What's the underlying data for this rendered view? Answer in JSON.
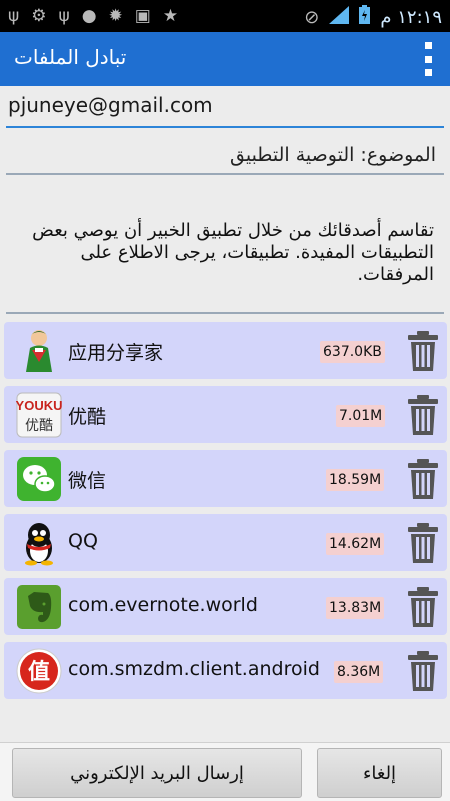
{
  "status_bar": {
    "time": "١٢:١٩ م",
    "icons": [
      "usb-icon",
      "android-debug-icon",
      "usb-icon",
      "android-face-icon",
      "settings-gear-icon",
      "image-icon",
      "star-icon"
    ],
    "right_icons": [
      "mute-icon",
      "signal-icon",
      "battery-charging-icon"
    ]
  },
  "app_bar": {
    "title": "تبادل الملفات",
    "menu_icon": "overflow-menu-icon"
  },
  "compose": {
    "to": "pjuneye@gmail.com",
    "subject": "الموضوع: التوصية التطبيق",
    "body": "تقاسم أصدقائك من خلال تطبيق الخبير أن يوصي بعض التطبيقات المفيدة. تطبيقات، يرجى الاطلاع على المرفقات."
  },
  "attachments": [
    {
      "name": "应用分享家",
      "size": "637.0KB",
      "icon": "share-expert-app-icon"
    },
    {
      "name": "优酷",
      "size": "7.01M",
      "icon": "youku-app-icon"
    },
    {
      "name": "微信",
      "size": "18.59M",
      "icon": "wechat-app-icon"
    },
    {
      "name": "QQ",
      "size": "14.62M",
      "icon": "qq-app-icon"
    },
    {
      "name": "com.evernote.world",
      "size": "13.83M",
      "icon": "evernote-app-icon"
    },
    {
      "name": "com.smzdm.client.android",
      "size": "8.36M",
      "icon": "smzdm-app-icon"
    }
  ],
  "buttons": {
    "send": "إرسال البريد الإلكتروني",
    "cancel": "إلغاء"
  },
  "icon_text": {
    "youku_top": "YOUKU",
    "youku_bottom": "优酷",
    "smzdm": "值"
  },
  "colors": {
    "app_bar": "#1f6fd1",
    "row_bg": "#d3d5fa",
    "size_bg": "#f4d0d0"
  }
}
